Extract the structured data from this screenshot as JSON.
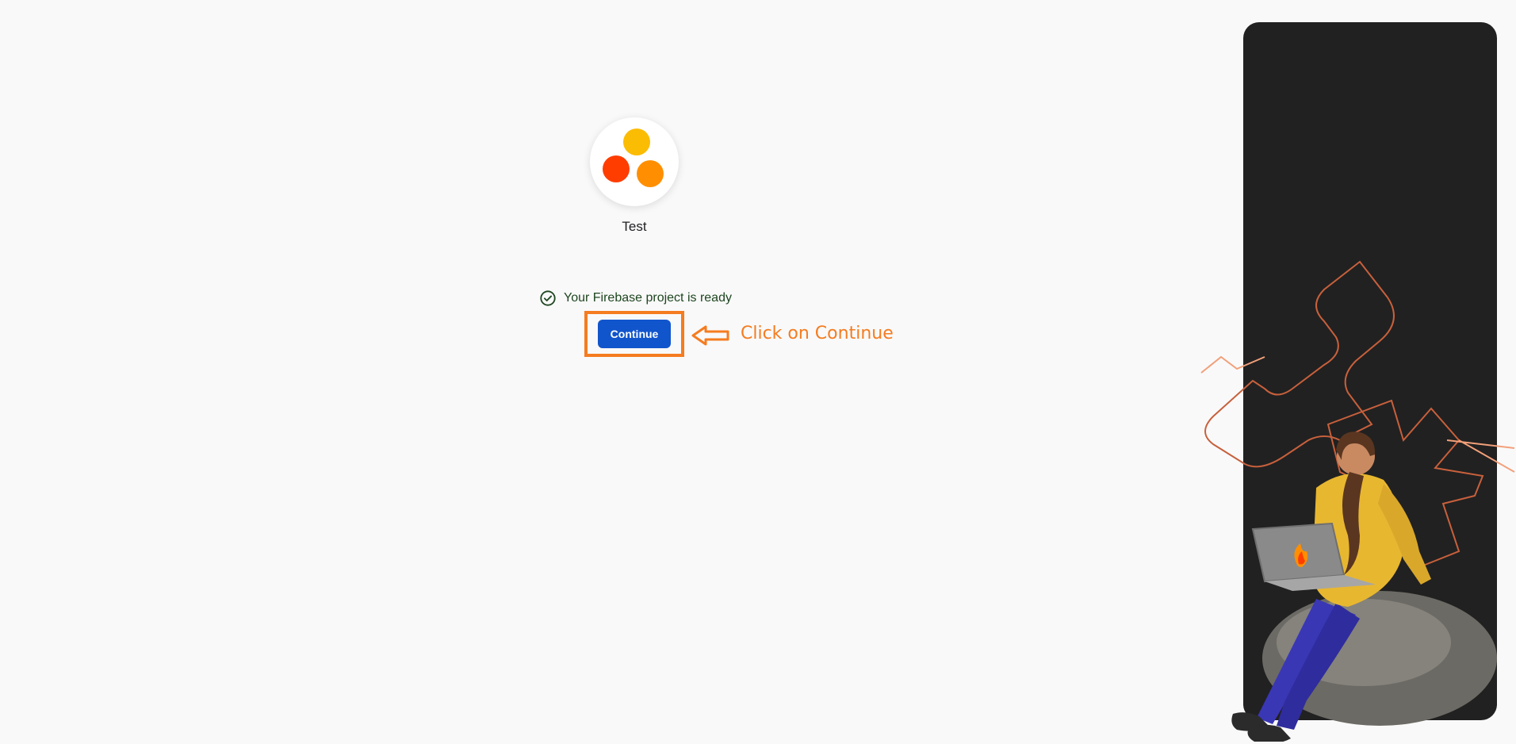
{
  "project": {
    "name": "Test",
    "logo_colors": {
      "yellow": "#fbbc04",
      "red": "#ff3d00",
      "orange": "#ff8f00"
    }
  },
  "status": {
    "text": "Your Firebase project is ready",
    "icon": "check-circle-icon",
    "color": "#1e4620"
  },
  "actions": {
    "continue_label": "Continue",
    "button_color": "#1155cc"
  },
  "annotation": {
    "text": "Click on Continue",
    "color": "#f57c20",
    "arrow_icon": "left-arrow-icon"
  },
  "side_panel": {
    "background": "#212121",
    "illustration": "person-with-laptop-on-beanbag"
  }
}
